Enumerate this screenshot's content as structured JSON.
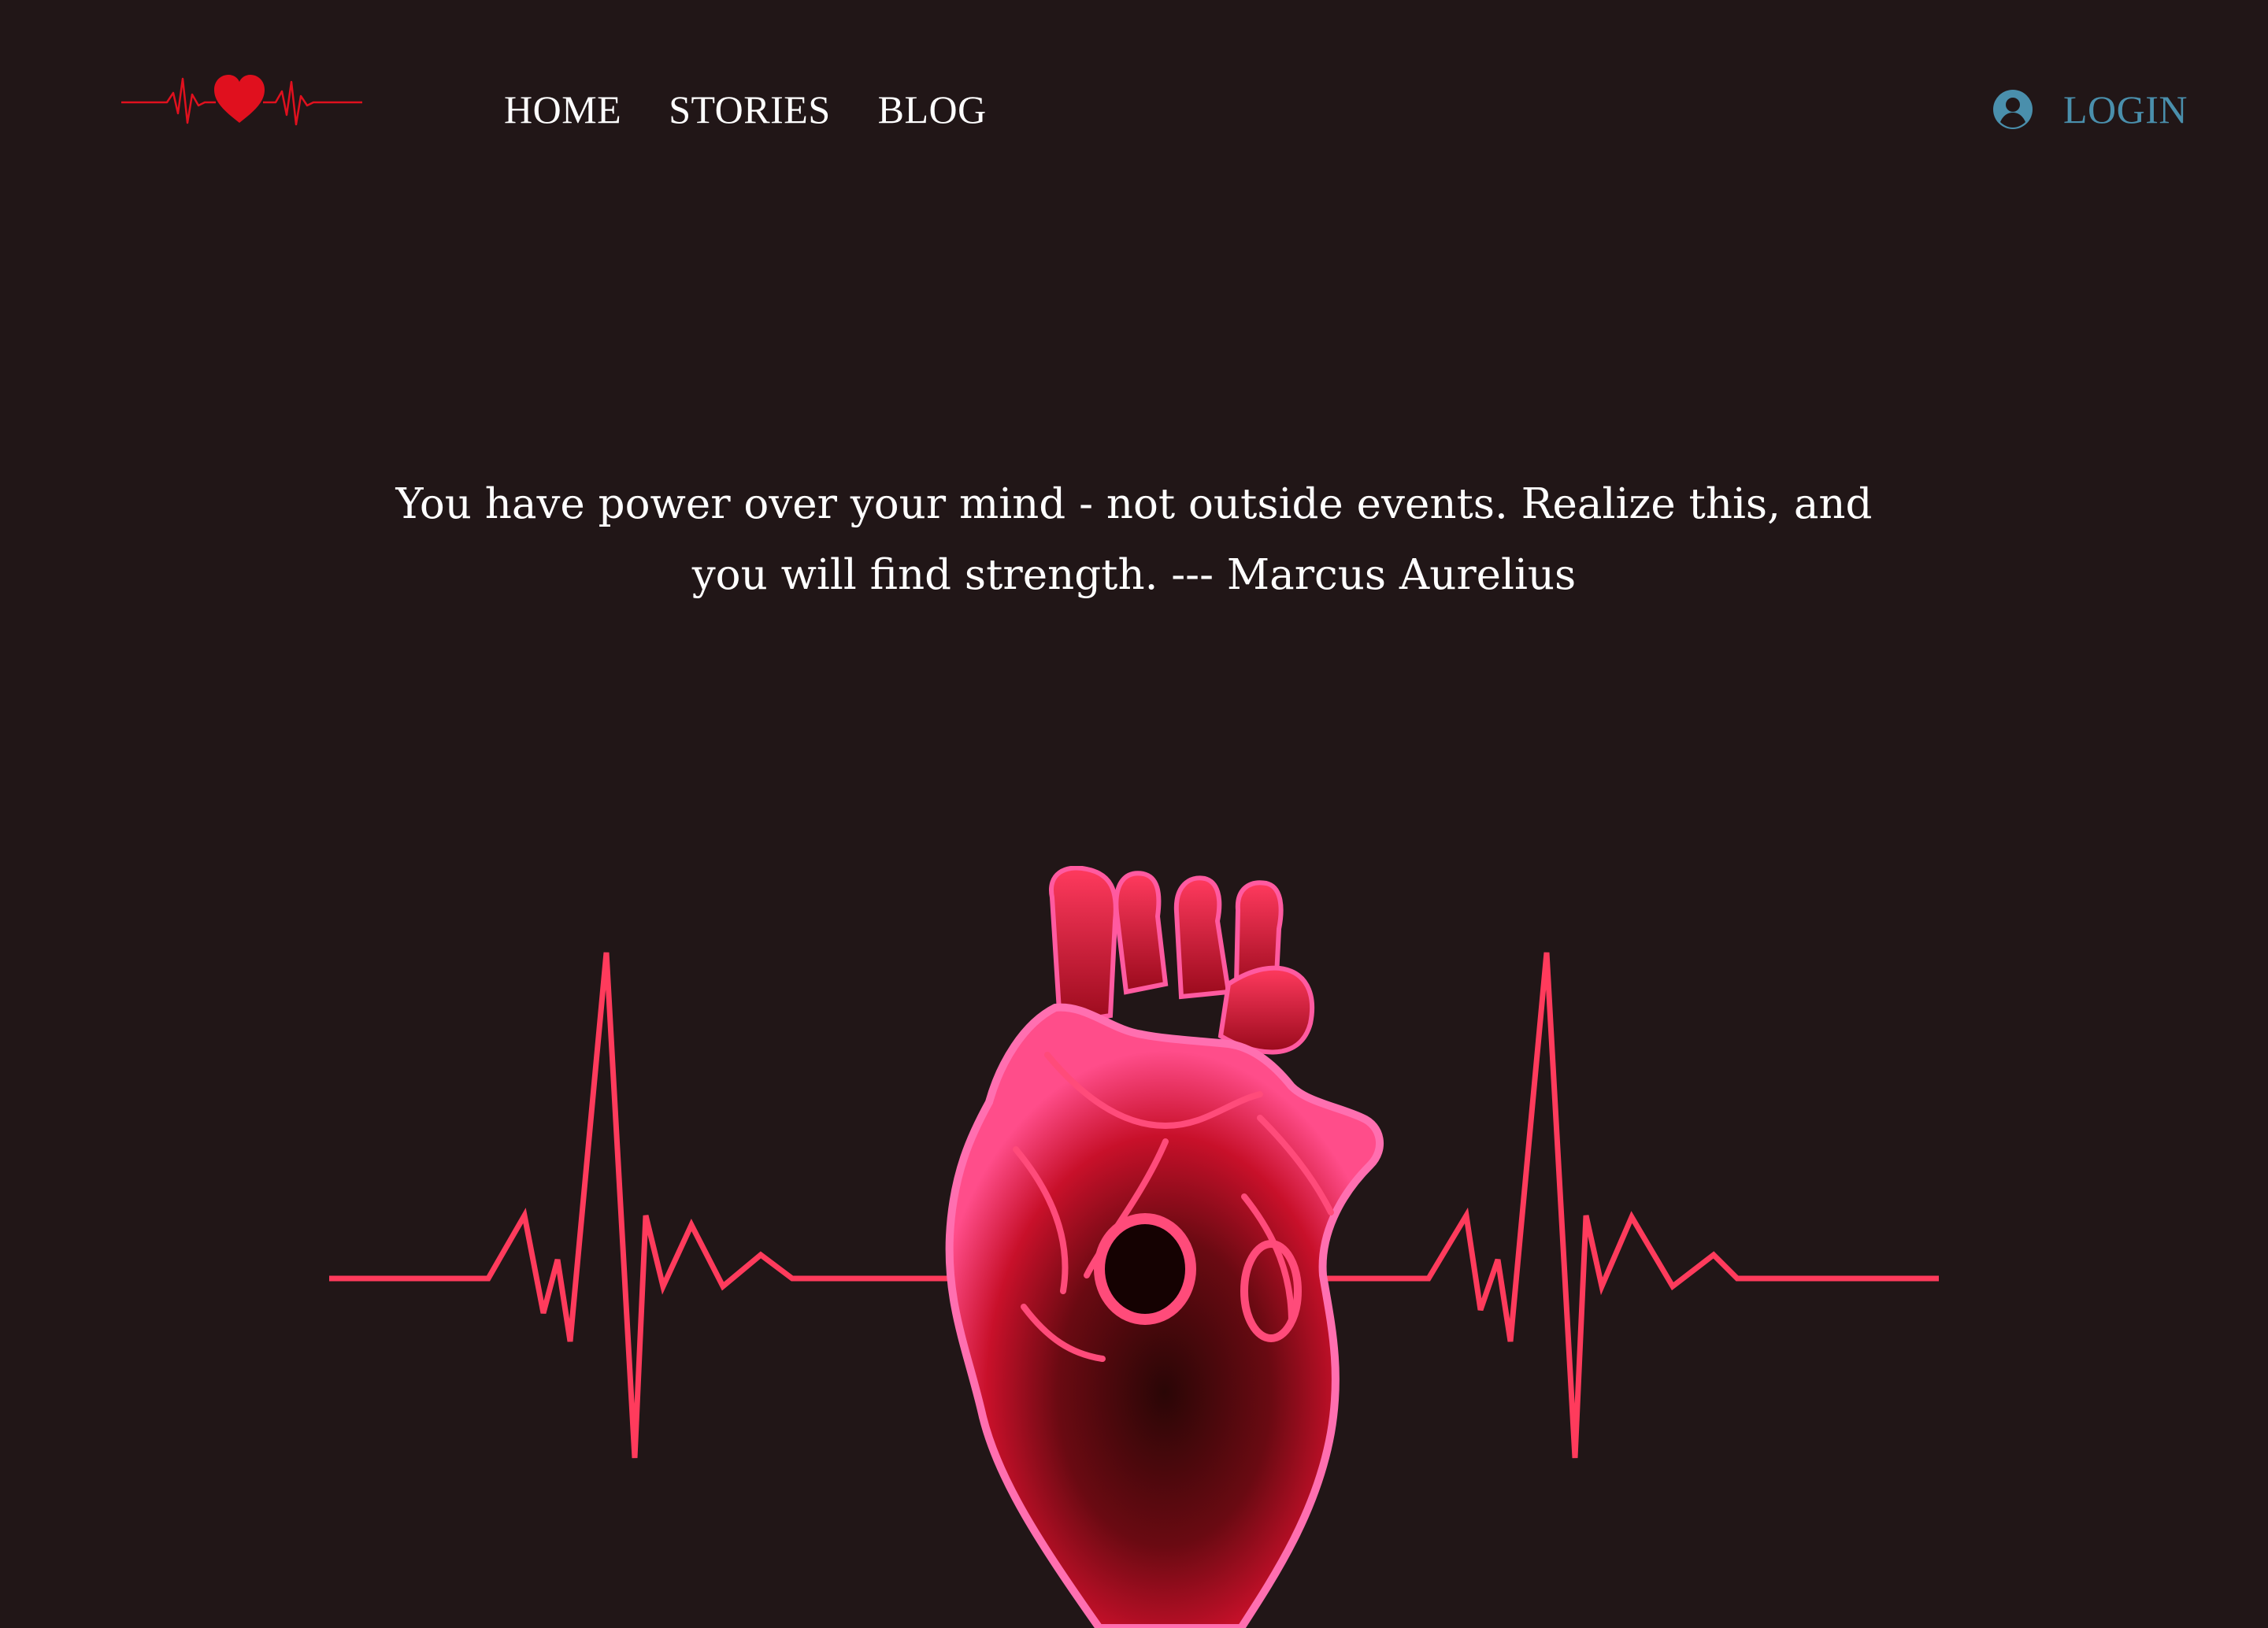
{
  "nav": {
    "items": [
      {
        "label": "HOME"
      },
      {
        "label": "STORIES"
      },
      {
        "label": "BLOG"
      }
    ],
    "login_label": "LOGIN"
  },
  "hero": {
    "quote": "You have power over your mind - not outside events. Realize this, and you will find strength. --- Marcus Aurelius"
  },
  "icons": {
    "logo": "heartbeat-heart-logo",
    "user": "user-circle-icon",
    "hero_image": "anatomical-heart-ekg-illustration"
  },
  "colors": {
    "background": "#211617",
    "nav_text": "#ffffff",
    "login_accent": "#4a8fac",
    "logo_red": "#e0101e",
    "ekg_line": "#ff3b5c"
  }
}
